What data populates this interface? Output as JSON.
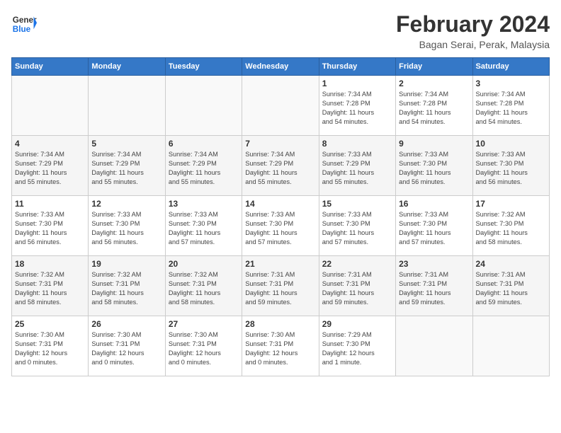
{
  "logo": {
    "text_general": "General",
    "text_blue": "Blue"
  },
  "header": {
    "month": "February 2024",
    "location": "Bagan Serai, Perak, Malaysia"
  },
  "weekdays": [
    "Sunday",
    "Monday",
    "Tuesday",
    "Wednesday",
    "Thursday",
    "Friday",
    "Saturday"
  ],
  "weeks": [
    [
      {
        "day": "",
        "info": ""
      },
      {
        "day": "",
        "info": ""
      },
      {
        "day": "",
        "info": ""
      },
      {
        "day": "",
        "info": ""
      },
      {
        "day": "1",
        "info": "Sunrise: 7:34 AM\nSunset: 7:28 PM\nDaylight: 11 hours\nand 54 minutes."
      },
      {
        "day": "2",
        "info": "Sunrise: 7:34 AM\nSunset: 7:28 PM\nDaylight: 11 hours\nand 54 minutes."
      },
      {
        "day": "3",
        "info": "Sunrise: 7:34 AM\nSunset: 7:28 PM\nDaylight: 11 hours\nand 54 minutes."
      }
    ],
    [
      {
        "day": "4",
        "info": "Sunrise: 7:34 AM\nSunset: 7:29 PM\nDaylight: 11 hours\nand 55 minutes."
      },
      {
        "day": "5",
        "info": "Sunrise: 7:34 AM\nSunset: 7:29 PM\nDaylight: 11 hours\nand 55 minutes."
      },
      {
        "day": "6",
        "info": "Sunrise: 7:34 AM\nSunset: 7:29 PM\nDaylight: 11 hours\nand 55 minutes."
      },
      {
        "day": "7",
        "info": "Sunrise: 7:34 AM\nSunset: 7:29 PM\nDaylight: 11 hours\nand 55 minutes."
      },
      {
        "day": "8",
        "info": "Sunrise: 7:33 AM\nSunset: 7:29 PM\nDaylight: 11 hours\nand 55 minutes."
      },
      {
        "day": "9",
        "info": "Sunrise: 7:33 AM\nSunset: 7:30 PM\nDaylight: 11 hours\nand 56 minutes."
      },
      {
        "day": "10",
        "info": "Sunrise: 7:33 AM\nSunset: 7:30 PM\nDaylight: 11 hours\nand 56 minutes."
      }
    ],
    [
      {
        "day": "11",
        "info": "Sunrise: 7:33 AM\nSunset: 7:30 PM\nDaylight: 11 hours\nand 56 minutes."
      },
      {
        "day": "12",
        "info": "Sunrise: 7:33 AM\nSunset: 7:30 PM\nDaylight: 11 hours\nand 56 minutes."
      },
      {
        "day": "13",
        "info": "Sunrise: 7:33 AM\nSunset: 7:30 PM\nDaylight: 11 hours\nand 57 minutes."
      },
      {
        "day": "14",
        "info": "Sunrise: 7:33 AM\nSunset: 7:30 PM\nDaylight: 11 hours\nand 57 minutes."
      },
      {
        "day": "15",
        "info": "Sunrise: 7:33 AM\nSunset: 7:30 PM\nDaylight: 11 hours\nand 57 minutes."
      },
      {
        "day": "16",
        "info": "Sunrise: 7:33 AM\nSunset: 7:30 PM\nDaylight: 11 hours\nand 57 minutes."
      },
      {
        "day": "17",
        "info": "Sunrise: 7:32 AM\nSunset: 7:30 PM\nDaylight: 11 hours\nand 58 minutes."
      }
    ],
    [
      {
        "day": "18",
        "info": "Sunrise: 7:32 AM\nSunset: 7:31 PM\nDaylight: 11 hours\nand 58 minutes."
      },
      {
        "day": "19",
        "info": "Sunrise: 7:32 AM\nSunset: 7:31 PM\nDaylight: 11 hours\nand 58 minutes."
      },
      {
        "day": "20",
        "info": "Sunrise: 7:32 AM\nSunset: 7:31 PM\nDaylight: 11 hours\nand 58 minutes."
      },
      {
        "day": "21",
        "info": "Sunrise: 7:31 AM\nSunset: 7:31 PM\nDaylight: 11 hours\nand 59 minutes."
      },
      {
        "day": "22",
        "info": "Sunrise: 7:31 AM\nSunset: 7:31 PM\nDaylight: 11 hours\nand 59 minutes."
      },
      {
        "day": "23",
        "info": "Sunrise: 7:31 AM\nSunset: 7:31 PM\nDaylight: 11 hours\nand 59 minutes."
      },
      {
        "day": "24",
        "info": "Sunrise: 7:31 AM\nSunset: 7:31 PM\nDaylight: 11 hours\nand 59 minutes."
      }
    ],
    [
      {
        "day": "25",
        "info": "Sunrise: 7:30 AM\nSunset: 7:31 PM\nDaylight: 12 hours\nand 0 minutes."
      },
      {
        "day": "26",
        "info": "Sunrise: 7:30 AM\nSunset: 7:31 PM\nDaylight: 12 hours\nand 0 minutes."
      },
      {
        "day": "27",
        "info": "Sunrise: 7:30 AM\nSunset: 7:31 PM\nDaylight: 12 hours\nand 0 minutes."
      },
      {
        "day": "28",
        "info": "Sunrise: 7:30 AM\nSunset: 7:31 PM\nDaylight: 12 hours\nand 0 minutes."
      },
      {
        "day": "29",
        "info": "Sunrise: 7:29 AM\nSunset: 7:30 PM\nDaylight: 12 hours\nand 1 minute."
      },
      {
        "day": "",
        "info": ""
      },
      {
        "day": "",
        "info": ""
      }
    ]
  ]
}
